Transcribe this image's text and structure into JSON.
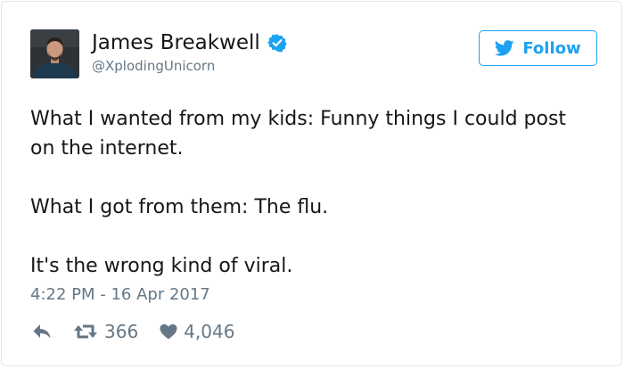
{
  "user": {
    "display_name": "James Breakwell",
    "handle": "@XplodingUnicorn",
    "verified": true
  },
  "follow_button": {
    "label": "Follow",
    "icon": "twitter-bird-icon"
  },
  "tweet": {
    "paragraphs": [
      "What I wanted from my kids: Funny things I could post on the internet.",
      "What I got from them: The flu.",
      "It's the wrong kind of viral."
    ],
    "timestamp": "4:22 PM - 16 Apr 2017"
  },
  "actions": {
    "reply_icon": "reply-arrow-icon",
    "retweet_icon": "retweet-icon",
    "retweet_count": "366",
    "like_icon": "heart-icon",
    "like_count": "4,046"
  },
  "colors": {
    "twitter_blue": "#1da1f2",
    "text_primary": "#14171a",
    "text_secondary": "#657786",
    "border": "#e1e8ed"
  }
}
